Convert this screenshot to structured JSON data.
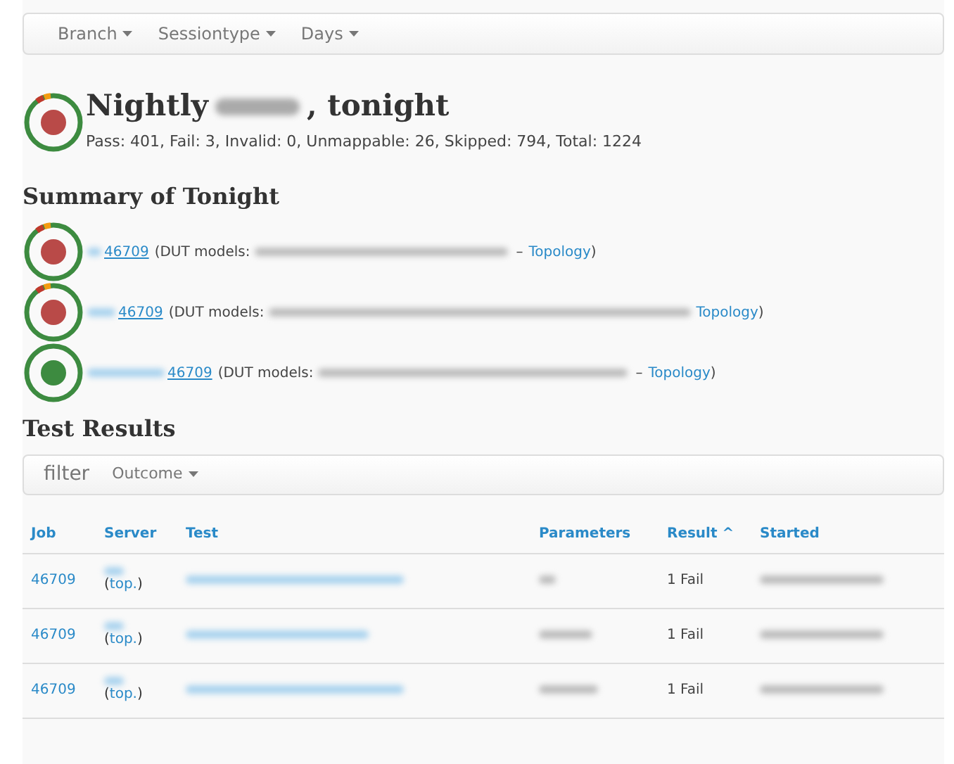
{
  "navbar": {
    "menus": [
      "Branch",
      "Sessiontype",
      "Days"
    ]
  },
  "header": {
    "title_start": "Nightly",
    "title_end": ", tonight",
    "kind": "failing",
    "color": "#b94a48",
    "stats": "Pass: 401, Fail: 3, Invalid: 0, Unmappable: 26, Skipped: 794, Total: 1224"
  },
  "summary": {
    "title": "Summary of Tonight",
    "items": [
      {
        "kind": "failing",
        "color": "#b94a48",
        "job": "46709",
        "dut_label": "(DUT models:",
        "separator": "–",
        "topology": "Topology",
        "close": ")"
      },
      {
        "kind": "failing",
        "color": "#b94a48",
        "job": "46709",
        "dut_label": "(DUT models:",
        "topology": "Topology",
        "close": ")"
      },
      {
        "kind": "passing",
        "color": "#3d8b40",
        "job": "46709",
        "dut_label": "(DUT models:",
        "separator": "–",
        "topology": "Topology",
        "close": ")"
      }
    ]
  },
  "results": {
    "title": "Test Results",
    "filter": {
      "label": "filter",
      "menus": [
        "Outcome"
      ]
    },
    "columns": [
      "Job",
      "Server",
      "Test",
      "Parameters",
      "Result ^",
      "Started"
    ],
    "rows": [
      {
        "job": "46709",
        "server_open": "(",
        "server_link": "top.",
        "server_close": ")",
        "result": "1 Fail"
      },
      {
        "job": "46709",
        "server_open": "(",
        "server_link": "top.",
        "server_close": ")",
        "result": "1 Fail"
      },
      {
        "job": "46709",
        "server_open": "(",
        "server_link": "top.",
        "server_close": ")",
        "result": "1 Fail"
      }
    ]
  }
}
